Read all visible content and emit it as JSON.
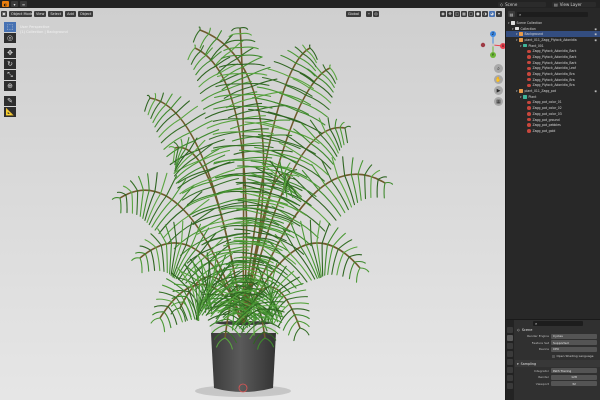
{
  "topbar": {
    "scene_label": "Scene",
    "view_layer_label": "View Layer"
  },
  "viewport": {
    "mode_label": "Object Mode",
    "menus": [
      "View",
      "Select",
      "Add",
      "Object"
    ],
    "transform_orientation": "Global",
    "overlay_info": [
      "User Perspective",
      "(1) Collection | Background"
    ],
    "gizmo_axes": {
      "x": "X",
      "y": "Y",
      "z": "Z"
    },
    "colors": {
      "background": "#d8d8d8",
      "x_axis": "#e8414e",
      "y_axis": "#6cb636",
      "z_axis": "#3d87e0",
      "pot": "#454545",
      "pot_rim": "#cfcfcf",
      "leaf": "#3f8a2e"
    }
  },
  "outliner": {
    "title": "Scene Collection",
    "search_placeholder": "",
    "items": [
      {
        "label": "Collection",
        "icon": "collection",
        "indent": 1,
        "selected": false,
        "eye": true
      },
      {
        "label": "Background",
        "icon": "object",
        "indent": 2,
        "selected": true,
        "eye": true
      },
      {
        "label": "plant_011_Zagg_Plylock_Adonidia",
        "icon": "object",
        "indent": 2,
        "selected": false,
        "eye": true
      },
      {
        "label": "Plant_001",
        "icon": "mesh",
        "indent": 3,
        "selected": false,
        "eye": false
      },
      {
        "label": "Zagg_Plylock_Adonidia_Bark",
        "icon": "material",
        "indent": 4,
        "selected": false,
        "eye": false
      },
      {
        "label": "Zagg_Plylock_Adonidia_Bark",
        "icon": "material",
        "indent": 4,
        "selected": false,
        "eye": false
      },
      {
        "label": "Zagg_Plylock_Adonidia_Bark",
        "icon": "material",
        "indent": 4,
        "selected": false,
        "eye": false
      },
      {
        "label": "Zagg_Plylock_Adonidia_Leaf",
        "icon": "material",
        "indent": 4,
        "selected": false,
        "eye": false
      },
      {
        "label": "Zagg_Plylock_Adonidia_Bra",
        "icon": "material",
        "indent": 4,
        "selected": false,
        "eye": false
      },
      {
        "label": "Zagg_Plylock_Adonidia_Bra",
        "icon": "material",
        "indent": 4,
        "selected": false,
        "eye": false
      },
      {
        "label": "Zagg_Plylock_Adonidia_Bra",
        "icon": "material",
        "indent": 4,
        "selected": false,
        "eye": false
      },
      {
        "label": "plant_011_Zagg_pot",
        "icon": "object",
        "indent": 2,
        "selected": false,
        "eye": true
      },
      {
        "label": "Plant",
        "icon": "mesh",
        "indent": 3,
        "selected": false,
        "eye": false
      },
      {
        "label": "Zagg_pot_color_01",
        "icon": "material",
        "indent": 4,
        "selected": false,
        "eye": false
      },
      {
        "label": "Zagg_pot_color_02",
        "icon": "material",
        "indent": 4,
        "selected": false,
        "eye": false
      },
      {
        "label": "Zagg_pot_color_03",
        "icon": "material",
        "indent": 4,
        "selected": false,
        "eye": false
      },
      {
        "label": "Zagg_pot_ground",
        "icon": "material",
        "indent": 4,
        "selected": false,
        "eye": false
      },
      {
        "label": "Zagg_pot_pebbles",
        "icon": "material",
        "indent": 4,
        "selected": false,
        "eye": false
      },
      {
        "label": "Zagg_pot_gold",
        "icon": "material",
        "indent": 4,
        "selected": false,
        "eye": false
      }
    ]
  },
  "properties": {
    "search_placeholder": "",
    "title": "Scene",
    "rows": [
      {
        "label": "Render Engine",
        "value": "Cycles"
      },
      {
        "label": "Feature Set",
        "value": "Supported"
      },
      {
        "label": "Device",
        "value": "CPU"
      }
    ],
    "checkbox_label": "Open Shading Language",
    "sampling_section": "Sampling",
    "integrator_label": "Integrator",
    "integrator_value": "Path Tracing",
    "render_label": "Render",
    "render_value": "128",
    "viewport_label": "Viewport",
    "viewport_value": "32"
  }
}
